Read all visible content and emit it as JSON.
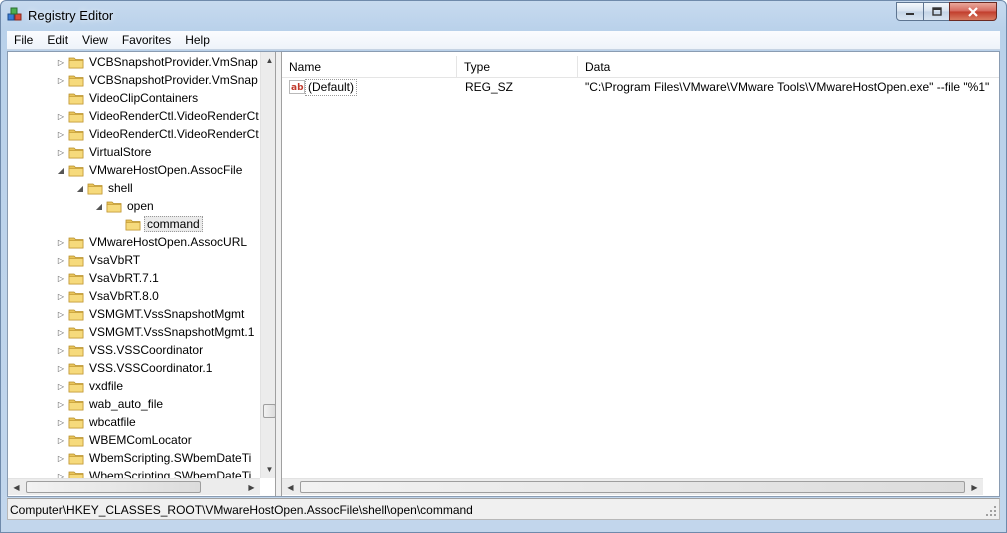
{
  "window": {
    "title": "Registry Editor",
    "icon": "registry-cubes-icon",
    "controls": [
      "minimize-icon",
      "maximize-icon",
      "close-icon"
    ]
  },
  "menu": [
    "File",
    "Edit",
    "View",
    "Favorites",
    "Help"
  ],
  "tree": {
    "items": [
      {
        "label": "VCBSnapshotProvider.VmSnap",
        "expandable": true,
        "expanded": false
      },
      {
        "label": "VCBSnapshotProvider.VmSnap",
        "expandable": true,
        "expanded": false
      },
      {
        "label": "VideoClipContainers",
        "expandable": false,
        "expanded": false
      },
      {
        "label": "VideoRenderCtl.VideoRenderCt",
        "expandable": true,
        "expanded": false
      },
      {
        "label": "VideoRenderCtl.VideoRenderCt",
        "expandable": true,
        "expanded": false
      },
      {
        "label": "VirtualStore",
        "expandable": true,
        "expanded": false
      },
      {
        "label": "VMwareHostOpen.AssocFile",
        "expandable": true,
        "expanded": true
      },
      {
        "label": "shell",
        "expandable": true,
        "expanded": true
      },
      {
        "label": "open",
        "expandable": true,
        "expanded": true
      },
      {
        "label": "command",
        "expandable": false,
        "expanded": false,
        "selected": true
      },
      {
        "label": "VMwareHostOpen.AssocURL",
        "expandable": true,
        "expanded": false
      },
      {
        "label": "VsaVbRT",
        "expandable": true,
        "expanded": false
      },
      {
        "label": "VsaVbRT.7.1",
        "expandable": true,
        "expanded": false
      },
      {
        "label": "VsaVbRT.8.0",
        "expandable": true,
        "expanded": false
      },
      {
        "label": "VSMGMT.VssSnapshotMgmt",
        "expandable": true,
        "expanded": false
      },
      {
        "label": "VSMGMT.VssSnapshotMgmt.1",
        "expandable": true,
        "expanded": false
      },
      {
        "label": "VSS.VSSCoordinator",
        "expandable": true,
        "expanded": false
      },
      {
        "label": "VSS.VSSCoordinator.1",
        "expandable": true,
        "expanded": false
      },
      {
        "label": "vxdfile",
        "expandable": true,
        "expanded": false
      },
      {
        "label": "wab_auto_file",
        "expandable": true,
        "expanded": false
      },
      {
        "label": "wbcatfile",
        "expandable": true,
        "expanded": false
      },
      {
        "label": "WBEMComLocator",
        "expandable": true,
        "expanded": false
      },
      {
        "label": "WbemScripting.SWbemDateTi",
        "expandable": true,
        "expanded": false
      },
      {
        "label": "WbemScripting.SWbemDateTi",
        "expandable": true,
        "expanded": false
      }
    ]
  },
  "list": {
    "columns": [
      "Name",
      "Type",
      "Data"
    ],
    "rows": [
      {
        "name": "(Default)",
        "type": "REG_SZ",
        "data": "\"C:\\Program Files\\VMware\\VMware Tools\\VMwareHostOpen.exe\" --file \"%1\"",
        "icon": "string-value-ab-icon"
      }
    ]
  },
  "status": {
    "path": "Computer\\HKEY_CLASSES_ROOT\\VMwareHostOpen.AssocFile\\shell\\open\\command"
  }
}
